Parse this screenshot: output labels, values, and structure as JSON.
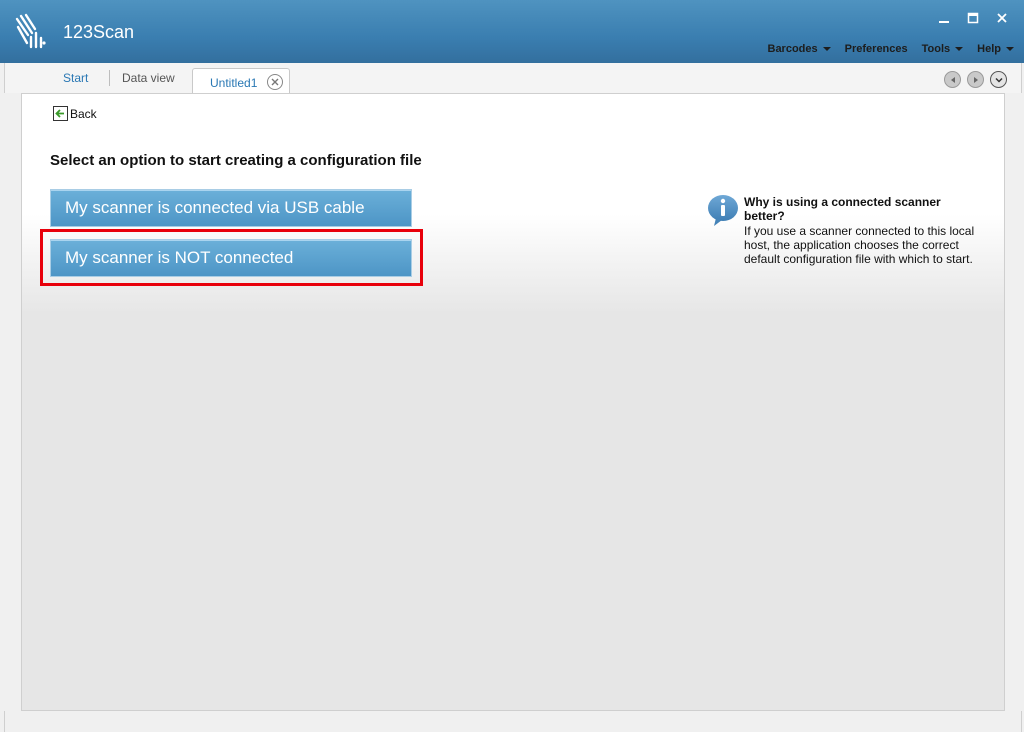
{
  "app": {
    "title": "123Scan",
    "brand_color": "#3a7eb0",
    "logo_icon": "zebra-head-icon"
  },
  "window_controls": {
    "minimize": "‗",
    "maximize": "☐",
    "close": "✕"
  },
  "menu": [
    {
      "label": "Barcodes",
      "has_dropdown": true
    },
    {
      "label": "Preferences",
      "has_dropdown": false
    },
    {
      "label": "Tools",
      "has_dropdown": true
    },
    {
      "label": "Help",
      "has_dropdown": true
    }
  ],
  "tabs": {
    "start": "Start",
    "data_view": "Data view",
    "active": "Untitled1"
  },
  "content": {
    "back_label": "Back",
    "heading": "Select an option to start creating a configuration file",
    "options": {
      "usb": "My scanner is connected via USB cable",
      "not_connected": "My scanner is NOT connected"
    },
    "highlight_color": "#e8000b",
    "info": {
      "icon": "info-icon",
      "title": "Why is using a connected scanner better?",
      "body": "If you use a scanner connected to this local host, the application chooses the correct default configuration file with which to start."
    }
  }
}
